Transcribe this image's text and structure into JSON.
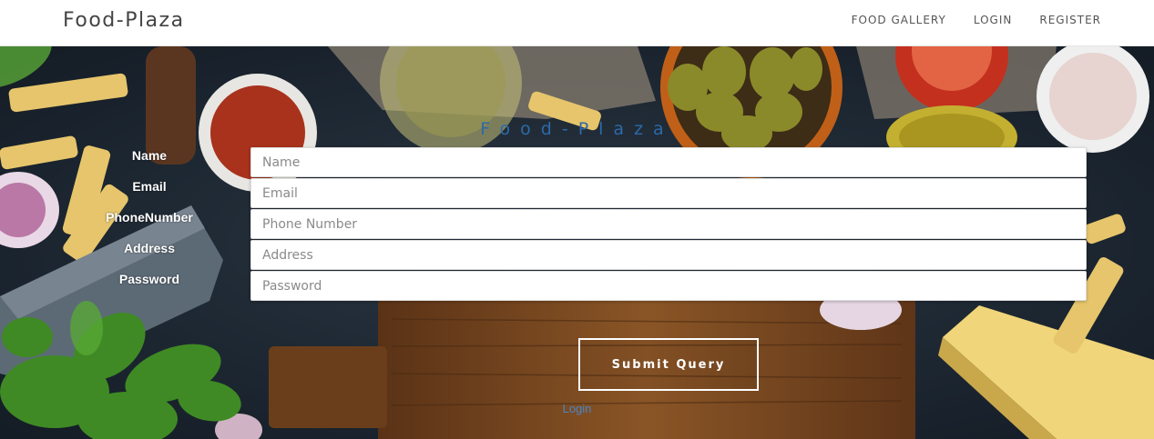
{
  "navbar": {
    "brand": "Food-Plaza",
    "links": [
      "FOOD GALLERY",
      "LOGIN",
      "REGISTER"
    ]
  },
  "form": {
    "title": "Food-Plaza",
    "labels": [
      "Name",
      "Email",
      "PhoneNumber",
      "Address",
      "Password"
    ],
    "placeholders": [
      "Name",
      "Email",
      "Phone Number",
      "Address",
      "Password"
    ],
    "submit_label": "Submit Query",
    "login_link": "Login"
  },
  "colors": {
    "title": "#2c6aa8",
    "link": "#4a86c5",
    "board": "#7a4a22"
  }
}
